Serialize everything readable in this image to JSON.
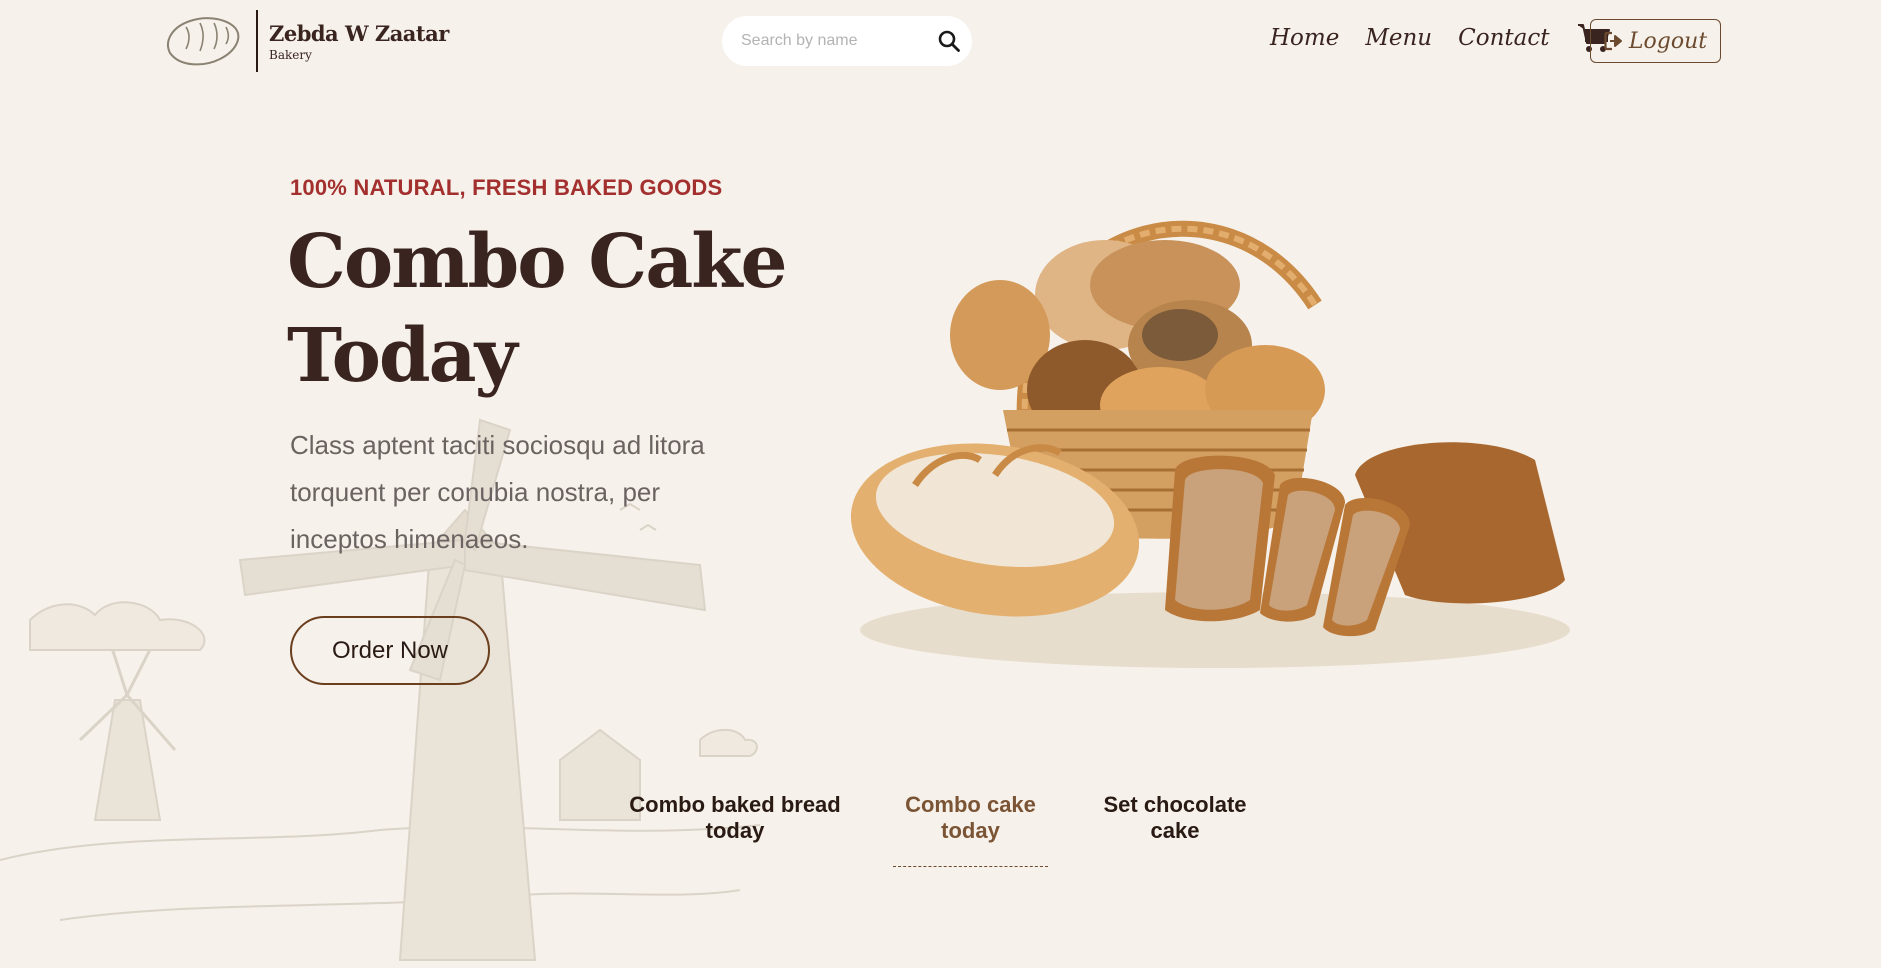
{
  "brand": {
    "name": "Zebda W Zaatar",
    "subtitle": "Bakery",
    "icon": "bread-loaf-icon"
  },
  "search": {
    "placeholder": "Search by name",
    "value": "",
    "icon": "search-icon"
  },
  "nav": {
    "items": [
      {
        "label": "Home"
      },
      {
        "label": "Menu"
      },
      {
        "label": "Contact"
      }
    ],
    "cart_icon": "shopping-cart-icon",
    "logout_label": "Logout",
    "logout_icon": "sign-out-icon"
  },
  "hero": {
    "eyebrow": "100% NATURAL, FRESH BAKED GOODS",
    "title_line1": "Combo Cake",
    "title_line2": "Today",
    "description": "Class aptent taciti sociosqu ad litora torquent per conubia nostra, per inceptos himenaeos.",
    "cta_label": "Order Now",
    "image": "bread-basket-image"
  },
  "tabs": {
    "items": [
      {
        "label": "Combo baked bread today",
        "active": false
      },
      {
        "label": "Combo cake today",
        "active": true
      },
      {
        "label": "Set chocolate cake",
        "active": false
      }
    ]
  },
  "colors": {
    "background": "#f6f1ea",
    "primary_text": "#3a2420",
    "accent_red": "#a3302e",
    "accent_brown": "#7a5434",
    "muted_text": "#6b6361"
  }
}
